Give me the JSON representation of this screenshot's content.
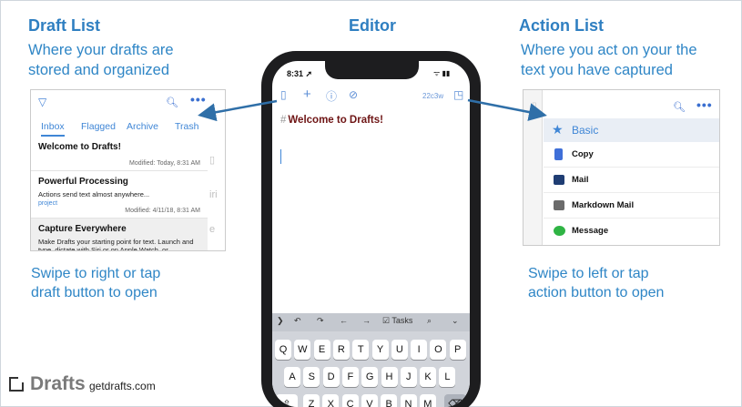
{
  "draft_list": {
    "heading": "Draft List",
    "description": "Where your drafts are\nstored and organized",
    "tabs": [
      "Inbox",
      "Flagged",
      "Archive",
      "Trash"
    ],
    "drafts": [
      {
        "title": "Welcome to Drafts!",
        "body": "",
        "tag": "",
        "meta": "Modified: Today, 8:31 AM"
      },
      {
        "title": "Powerful Processing",
        "body": "Actions send text almost anywhere...",
        "tag": "project",
        "meta": "Modified: 4/11/18, 8:31 AM"
      },
      {
        "title": "Capture Everywhere",
        "body": "Make Drafts your starting point for text. Launch and type, dictate with Siri or on Apple Watch, or",
        "tag": "",
        "meta": ""
      }
    ],
    "instruction": "Swipe to right or tap\ndraft button to open"
  },
  "editor": {
    "heading": "Editor",
    "status_time": "8:31",
    "status_arrow": "➚",
    "char_count": "22c3w",
    "draft_title": "Welcome to Drafts!",
    "draft_title_prefix": "#",
    "keyboard": {
      "toolbar_label": "Tasks",
      "row1": [
        "Q",
        "W",
        "E",
        "R",
        "T",
        "Y",
        "U",
        "I",
        "O",
        "P"
      ],
      "row2": [
        "A",
        "S",
        "D",
        "F",
        "G",
        "H",
        "J",
        "K",
        "L"
      ],
      "row3": [
        "Z",
        "X",
        "C",
        "V",
        "B",
        "N",
        "M"
      ]
    }
  },
  "action_list": {
    "heading": "Action List",
    "description": "Where you act on your the\ntext you have captured",
    "group": "Basic",
    "actions": [
      {
        "label": "Copy",
        "icon": "clipboard-icon",
        "color": "#3f6fd8"
      },
      {
        "label": "Mail",
        "icon": "mail-icon",
        "color": "#1f3d73"
      },
      {
        "label": "Markdown Mail",
        "icon": "mail-icon",
        "color": "#6b6b6b"
      },
      {
        "label": "Message",
        "icon": "message-icon",
        "color": "#2fb444"
      }
    ],
    "instruction": "Swipe to left or tap\naction button to open"
  },
  "branding": {
    "name": "Drafts",
    "url": "getdrafts.com"
  },
  "colors": {
    "accent": "#2f86c6",
    "title_red": "#6e1414"
  }
}
